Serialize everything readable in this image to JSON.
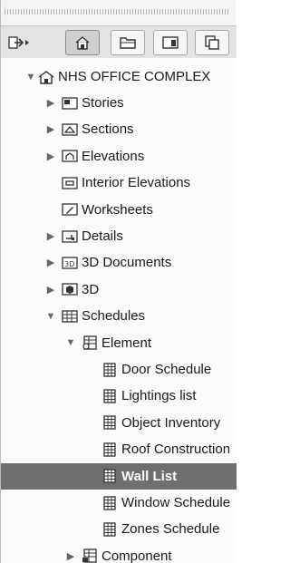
{
  "toolbar": {
    "buttons": [
      {
        "icon": "export-arrow-icon"
      },
      {
        "icon": "project-map-icon",
        "active": true
      },
      {
        "icon": "view-map-icon"
      },
      {
        "icon": "layout-book-icon"
      },
      {
        "icon": "publisher-icon"
      }
    ]
  },
  "tree": {
    "root": {
      "label": "NHS OFFICE COMPLEX",
      "icon": "house-icon",
      "expanded": true
    },
    "items": [
      {
        "label": "Stories",
        "icon": "stories-icon",
        "expander": "collapsed"
      },
      {
        "label": "Sections",
        "icon": "section-icon",
        "expander": "collapsed"
      },
      {
        "label": "Elevations",
        "icon": "elevation-icon",
        "expander": "collapsed"
      },
      {
        "label": "Interior Elevations",
        "icon": "interior-elevation-icon",
        "expander": "none"
      },
      {
        "label": "Worksheets",
        "icon": "worksheet-icon",
        "expander": "none"
      },
      {
        "label": "Details",
        "icon": "detail-icon",
        "expander": "collapsed"
      },
      {
        "label": "3D Documents",
        "icon": "3d-document-icon",
        "expander": "collapsed"
      },
      {
        "label": "3D",
        "icon": "3d-icon",
        "expander": "collapsed"
      },
      {
        "label": "Schedules",
        "icon": "schedule-icon",
        "expander": "expanded"
      },
      {
        "label": "Element",
        "icon": "element-schedule-icon",
        "expander": "expanded"
      },
      {
        "label": "Door Schedule",
        "icon": "schedule-item-icon",
        "expander": "none"
      },
      {
        "label": "Lightings list",
        "icon": "schedule-item-icon",
        "expander": "none"
      },
      {
        "label": "Object Inventory",
        "icon": "schedule-item-icon",
        "expander": "none"
      },
      {
        "label": "Roof Construction",
        "icon": "schedule-item-icon",
        "expander": "none"
      },
      {
        "label": "Wall List",
        "icon": "schedule-item-icon",
        "expander": "none",
        "selected": true
      },
      {
        "label": "Window Schedule",
        "icon": "schedule-item-icon",
        "expander": "none"
      },
      {
        "label": "Zones Schedule",
        "icon": "schedule-item-icon",
        "expander": "none"
      },
      {
        "label": "Component",
        "icon": "component-schedule-icon",
        "expander": "collapsed"
      }
    ]
  }
}
